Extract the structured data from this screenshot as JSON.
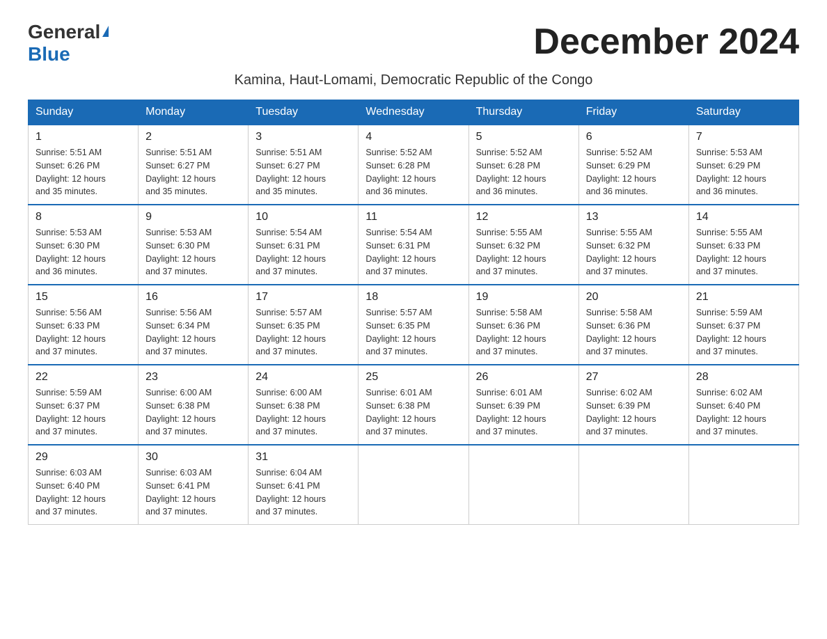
{
  "logo": {
    "general": "General",
    "blue": "Blue"
  },
  "title": "December 2024",
  "subtitle": "Kamina, Haut-Lomami, Democratic Republic of the Congo",
  "days_of_week": [
    "Sunday",
    "Monday",
    "Tuesday",
    "Wednesday",
    "Thursday",
    "Friday",
    "Saturday"
  ],
  "weeks": [
    [
      {
        "day": "1",
        "sunrise": "5:51 AM",
        "sunset": "6:26 PM",
        "daylight": "12 hours and 35 minutes."
      },
      {
        "day": "2",
        "sunrise": "5:51 AM",
        "sunset": "6:27 PM",
        "daylight": "12 hours and 35 minutes."
      },
      {
        "day": "3",
        "sunrise": "5:51 AM",
        "sunset": "6:27 PM",
        "daylight": "12 hours and 35 minutes."
      },
      {
        "day": "4",
        "sunrise": "5:52 AM",
        "sunset": "6:28 PM",
        "daylight": "12 hours and 36 minutes."
      },
      {
        "day": "5",
        "sunrise": "5:52 AM",
        "sunset": "6:28 PM",
        "daylight": "12 hours and 36 minutes."
      },
      {
        "day": "6",
        "sunrise": "5:52 AM",
        "sunset": "6:29 PM",
        "daylight": "12 hours and 36 minutes."
      },
      {
        "day": "7",
        "sunrise": "5:53 AM",
        "sunset": "6:29 PM",
        "daylight": "12 hours and 36 minutes."
      }
    ],
    [
      {
        "day": "8",
        "sunrise": "5:53 AM",
        "sunset": "6:30 PM",
        "daylight": "12 hours and 36 minutes."
      },
      {
        "day": "9",
        "sunrise": "5:53 AM",
        "sunset": "6:30 PM",
        "daylight": "12 hours and 37 minutes."
      },
      {
        "day": "10",
        "sunrise": "5:54 AM",
        "sunset": "6:31 PM",
        "daylight": "12 hours and 37 minutes."
      },
      {
        "day": "11",
        "sunrise": "5:54 AM",
        "sunset": "6:31 PM",
        "daylight": "12 hours and 37 minutes."
      },
      {
        "day": "12",
        "sunrise": "5:55 AM",
        "sunset": "6:32 PM",
        "daylight": "12 hours and 37 minutes."
      },
      {
        "day": "13",
        "sunrise": "5:55 AM",
        "sunset": "6:32 PM",
        "daylight": "12 hours and 37 minutes."
      },
      {
        "day": "14",
        "sunrise": "5:55 AM",
        "sunset": "6:33 PM",
        "daylight": "12 hours and 37 minutes."
      }
    ],
    [
      {
        "day": "15",
        "sunrise": "5:56 AM",
        "sunset": "6:33 PM",
        "daylight": "12 hours and 37 minutes."
      },
      {
        "day": "16",
        "sunrise": "5:56 AM",
        "sunset": "6:34 PM",
        "daylight": "12 hours and 37 minutes."
      },
      {
        "day": "17",
        "sunrise": "5:57 AM",
        "sunset": "6:35 PM",
        "daylight": "12 hours and 37 minutes."
      },
      {
        "day": "18",
        "sunrise": "5:57 AM",
        "sunset": "6:35 PM",
        "daylight": "12 hours and 37 minutes."
      },
      {
        "day": "19",
        "sunrise": "5:58 AM",
        "sunset": "6:36 PM",
        "daylight": "12 hours and 37 minutes."
      },
      {
        "day": "20",
        "sunrise": "5:58 AM",
        "sunset": "6:36 PM",
        "daylight": "12 hours and 37 minutes."
      },
      {
        "day": "21",
        "sunrise": "5:59 AM",
        "sunset": "6:37 PM",
        "daylight": "12 hours and 37 minutes."
      }
    ],
    [
      {
        "day": "22",
        "sunrise": "5:59 AM",
        "sunset": "6:37 PM",
        "daylight": "12 hours and 37 minutes."
      },
      {
        "day": "23",
        "sunrise": "6:00 AM",
        "sunset": "6:38 PM",
        "daylight": "12 hours and 37 minutes."
      },
      {
        "day": "24",
        "sunrise": "6:00 AM",
        "sunset": "6:38 PM",
        "daylight": "12 hours and 37 minutes."
      },
      {
        "day": "25",
        "sunrise": "6:01 AM",
        "sunset": "6:38 PM",
        "daylight": "12 hours and 37 minutes."
      },
      {
        "day": "26",
        "sunrise": "6:01 AM",
        "sunset": "6:39 PM",
        "daylight": "12 hours and 37 minutes."
      },
      {
        "day": "27",
        "sunrise": "6:02 AM",
        "sunset": "6:39 PM",
        "daylight": "12 hours and 37 minutes."
      },
      {
        "day": "28",
        "sunrise": "6:02 AM",
        "sunset": "6:40 PM",
        "daylight": "12 hours and 37 minutes."
      }
    ],
    [
      {
        "day": "29",
        "sunrise": "6:03 AM",
        "sunset": "6:40 PM",
        "daylight": "12 hours and 37 minutes."
      },
      {
        "day": "30",
        "sunrise": "6:03 AM",
        "sunset": "6:41 PM",
        "daylight": "12 hours and 37 minutes."
      },
      {
        "day": "31",
        "sunrise": "6:04 AM",
        "sunset": "6:41 PM",
        "daylight": "12 hours and 37 minutes."
      },
      null,
      null,
      null,
      null
    ]
  ],
  "labels": {
    "sunrise": "Sunrise:",
    "sunset": "Sunset:",
    "daylight": "Daylight:"
  }
}
